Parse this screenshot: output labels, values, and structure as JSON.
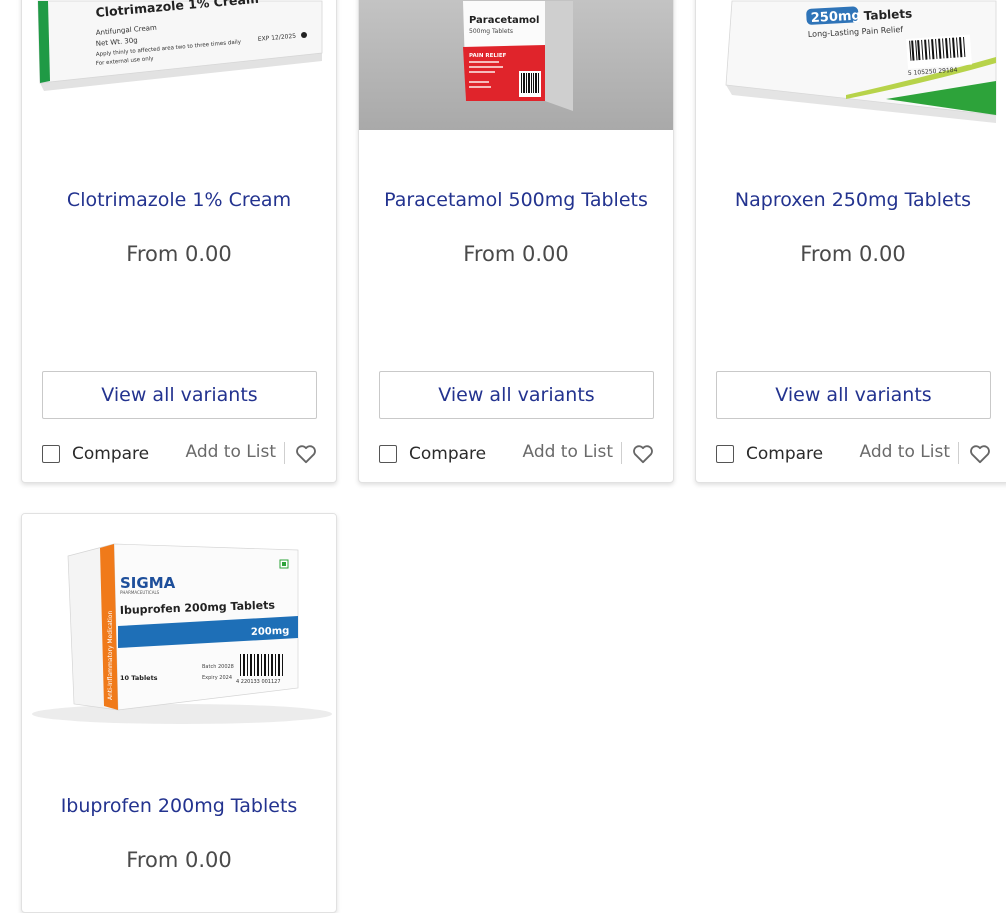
{
  "products": [
    {
      "name": "Clotrimazole 1% Cream",
      "price": "From 0.00",
      "variants_label": "View all variants",
      "compare_label": "Compare",
      "add_to_list_label": "Add to List",
      "package": {
        "name": "Clotrimazole 1% Cream",
        "line1": "Antifungal Cream",
        "line2": "Net Wt. 30g",
        "line3": "Apply thinly to affected area two to three times daily",
        "line4": "For external use only",
        "exp": "EXP 12/2025"
      }
    },
    {
      "name": "Paracetamol 500mg Tablets",
      "price": "From 0.00",
      "variants_label": "View all variants",
      "compare_label": "Compare",
      "add_to_list_label": "Add to List",
      "package": {
        "name": "Paracetamol",
        "strength": "500mg Tablets",
        "band": "PAIN RELIEF"
      }
    },
    {
      "name": "Naproxen 250mg Tablets",
      "price": "From 0.00",
      "variants_label": "View all variants",
      "compare_label": "Compare",
      "add_to_list_label": "Add to List",
      "package": {
        "badge": "250mg",
        "badge_suffix": "Tablets",
        "tagline": "Long-Lasting Pain Relief",
        "barcode": "5 105250 29184"
      }
    },
    {
      "name": "Ibuprofen 200mg Tablets",
      "price": "From 0.00",
      "package": {
        "brand": "SIGMA",
        "brand_sub": "PHARMACEUTICALS",
        "name": "Ibuprofen 200mg Tablets",
        "strength": "200mg",
        "side": "Anti-Inflammatory Medication",
        "count": "10 Tablets",
        "batch": "Batch 20028",
        "expiry": "Expiry 2024",
        "barcode": "4 220133 001127"
      }
    }
  ],
  "colors": {
    "title": "#23338f",
    "price": "#4a4a4a",
    "clotri_green": "#1f9a45",
    "para_red": "#e0242b",
    "nap_green": "#2da33a",
    "nap_blue": "#2f74b8",
    "ibu_blue": "#1e6fb7",
    "ibu_orange": "#f07a1a"
  },
  "icons": {
    "checkbox": "empty-checkbox",
    "wishlist": "heart-outline-icon"
  }
}
